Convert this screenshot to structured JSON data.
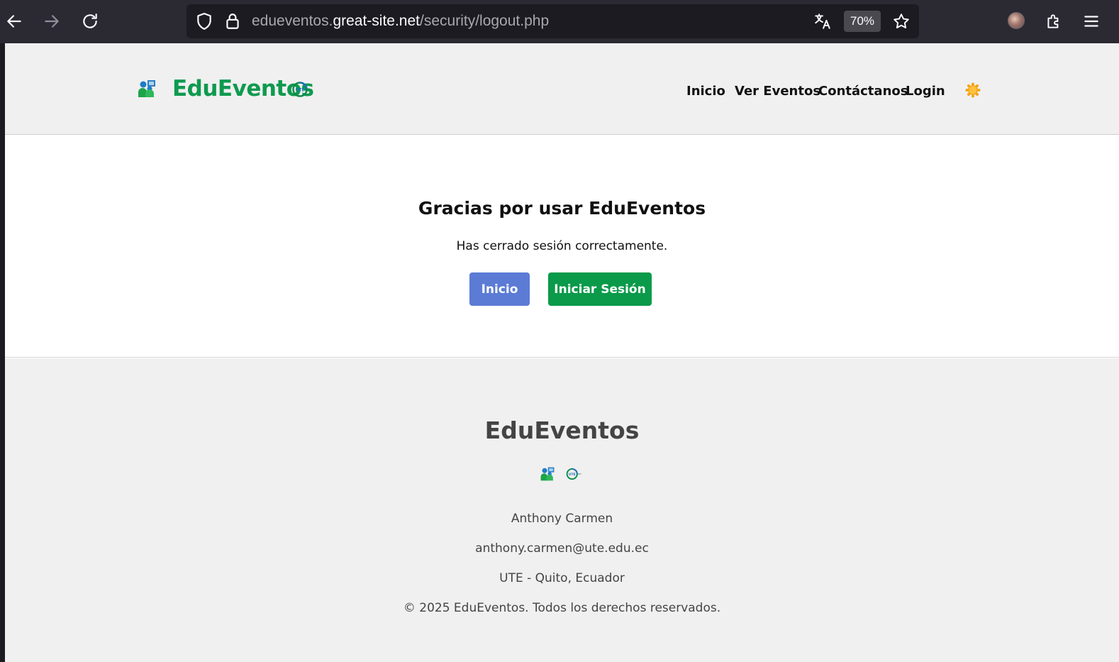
{
  "browser": {
    "url_prefix": "edueventos.",
    "url_host": "great-site.net",
    "url_path": "/security/logout.php",
    "zoom": "70%"
  },
  "header": {
    "brand": "EduEventos",
    "nav": {
      "inicio": "Inicio",
      "ver_eventos": "Ver Eventos",
      "contactanos": "Contáctanos",
      "login": "Login"
    }
  },
  "main": {
    "title": "Gracias por usar EduEventos",
    "message": "Has cerrado sesión correctamente.",
    "btn_inicio": "Inicio",
    "btn_login": "Iniciar Sesión"
  },
  "footer": {
    "title": "EduEventos",
    "author": "Anthony Carmen",
    "email": "anthony.carmen@ute.edu.ec",
    "location": "UTE - Quito, Ecuador",
    "copyright": "© 2025 EduEventos. Todos los derechos reservados."
  },
  "colors": {
    "brand_green": "#0e9a4f",
    "button_blue": "#5b7bd5",
    "button_green": "#0a9a4a",
    "chrome_bg": "#2b2a33"
  },
  "icons": [
    "back-icon",
    "forward-icon",
    "reload-icon",
    "shield-icon",
    "lock-icon",
    "translate-icon",
    "star-icon",
    "extensions-icon",
    "menu-icon",
    "people-logo-icon",
    "ute-logo-icon",
    "sun-icon"
  ]
}
